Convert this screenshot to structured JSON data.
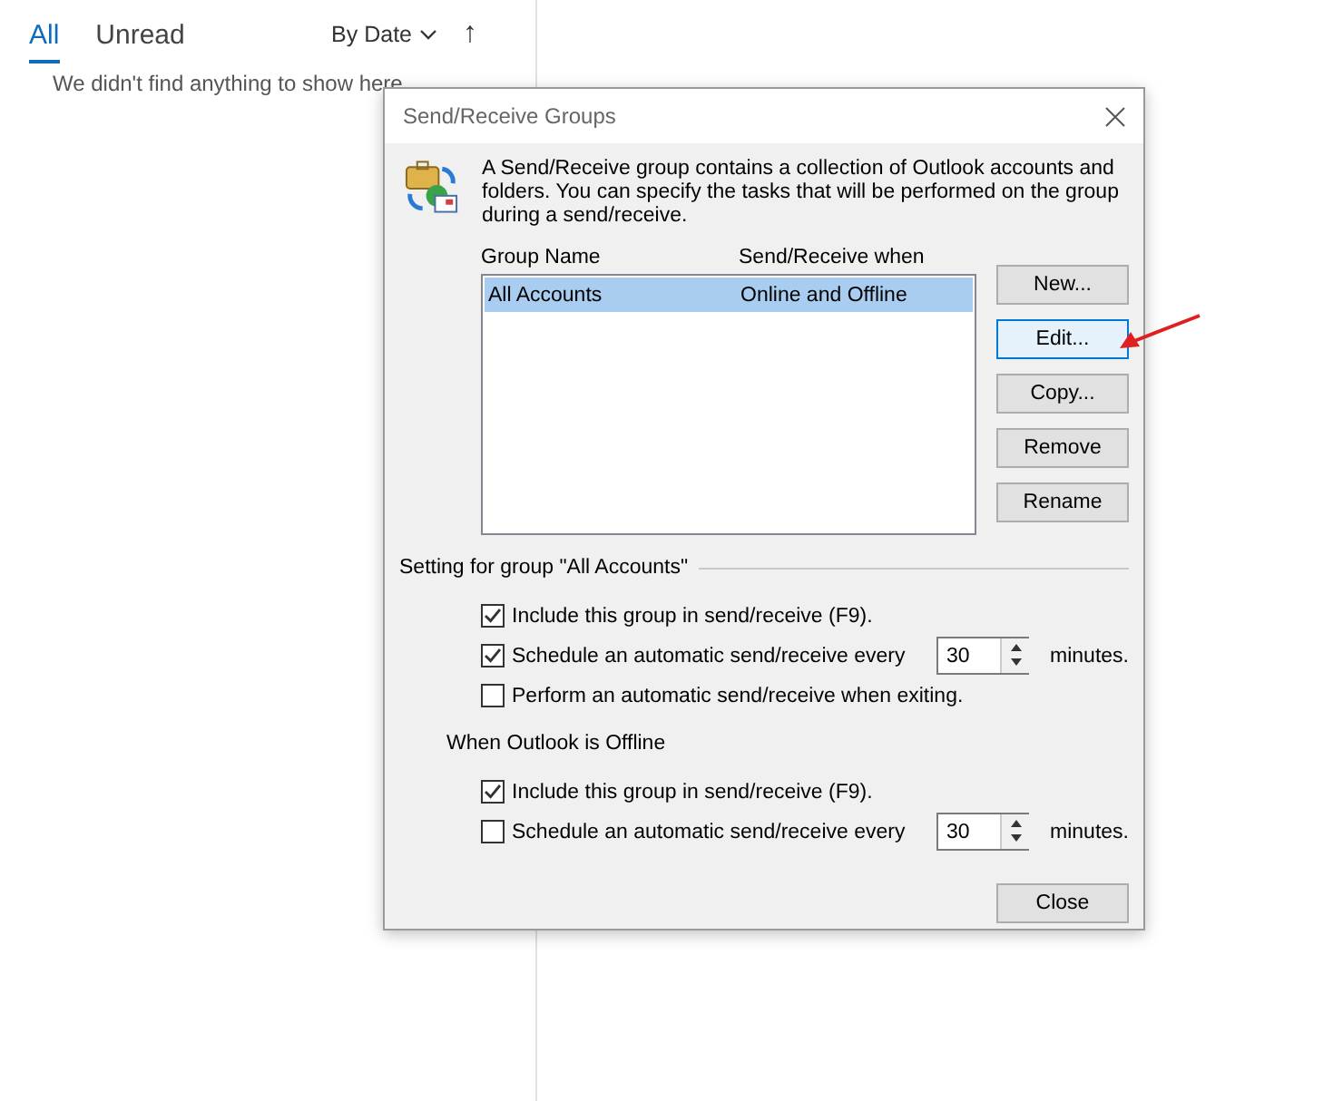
{
  "mail_list": {
    "tabs": [
      {
        "label": "All",
        "selected": true
      },
      {
        "label": "Unread",
        "selected": false
      }
    ],
    "sort": "By Date",
    "sort_direction": "↑",
    "empty_message": "We didn't find anything to show here"
  },
  "dialog": {
    "title": "Send/Receive Groups",
    "description": "A Send/Receive group contains a collection of Outlook accounts and folders. You can specify the tasks that will be performed on the group during a send/receive.",
    "groups_list": {
      "columns": [
        "Group Name",
        "Send/Receive when"
      ],
      "rows": [
        {
          "name": "All Accounts",
          "when": "Online and Offline",
          "selected": true
        }
      ]
    },
    "buttons": [
      {
        "label": "New...",
        "focused": false
      },
      {
        "label": "Edit...",
        "focused": true
      },
      {
        "label": "Copy...",
        "focused": false
      },
      {
        "label": "Remove",
        "focused": false
      },
      {
        "label": "Rename",
        "focused": false
      }
    ],
    "sections": [
      {
        "title": "Setting for group \"All Accounts\"",
        "kind": "ruled",
        "options": [
          {
            "kind": "checkbox",
            "label": "Include this group in send/receive (F9).",
            "checked": true
          },
          {
            "kind": "schedule",
            "label": "Schedule an automatic send/receive every",
            "checked": true,
            "value": "30",
            "unit": "minutes."
          },
          {
            "kind": "checkbox",
            "label": "Perform an automatic send/receive when exiting.",
            "checked": false
          }
        ]
      },
      {
        "title": "When Outlook is Offline",
        "kind": "plain",
        "options": [
          {
            "kind": "checkbox",
            "label": "Include this group in send/receive (F9).",
            "checked": true
          },
          {
            "kind": "schedule",
            "label": "Schedule an automatic send/receive every",
            "checked": false,
            "value": "30",
            "unit": "minutes."
          }
        ]
      }
    ],
    "close_button": "Close"
  }
}
